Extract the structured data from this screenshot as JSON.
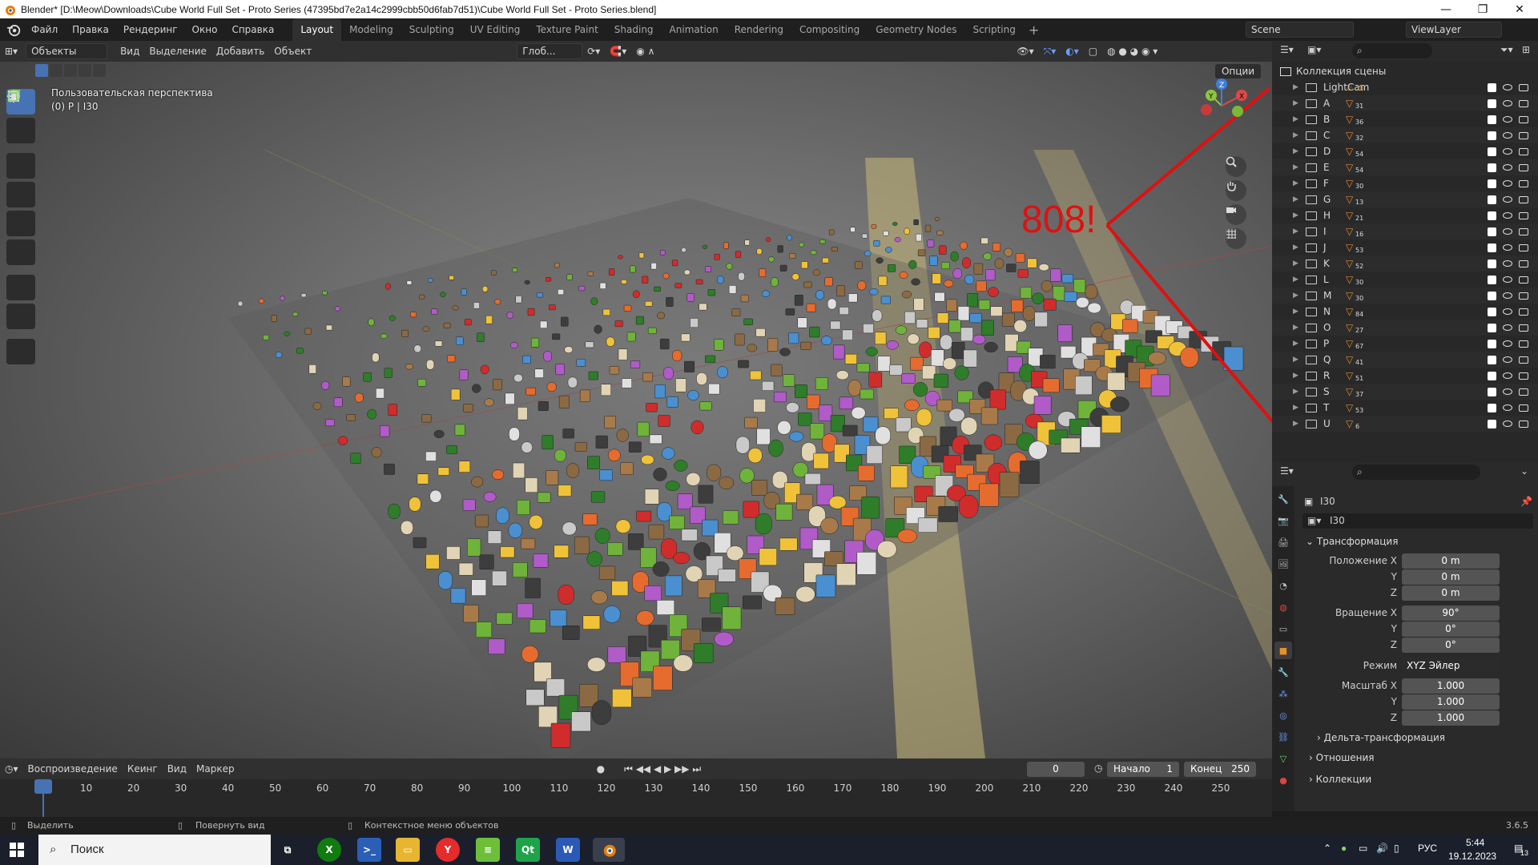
{
  "window": {
    "title": "Blender* [D:\\Meow\\Downloads\\Cube World Full Set - Proto Series (47395bd7e2a14c2999cbb50d6fab7d51)\\Cube World Full Set - Proto Series.blend]",
    "minimize": "—",
    "maximize": "❐",
    "close": "✕"
  },
  "menu": {
    "items": [
      "Файл",
      "Правка",
      "Рендеринг",
      "Окно",
      "Справка"
    ],
    "workspaces": [
      "Layout",
      "Modeling",
      "Sculpting",
      "UV Editing",
      "Texture Paint",
      "Shading",
      "Animation",
      "Rendering",
      "Compositing",
      "Geometry Nodes",
      "Scripting"
    ],
    "active_workspace": "Layout",
    "add_tab": "+",
    "scene": "Scene",
    "view_layer": "ViewLayer"
  },
  "viewport_header": {
    "mode": "Объекты",
    "menus": [
      "Вид",
      "Выделение",
      "Добавить",
      "Объект"
    ],
    "transform_orientation": "Глоб...",
    "options": "Опции"
  },
  "viewport": {
    "perspective": "Пользовательская перспектива",
    "context": "(0) P | I30",
    "annotation": "808!",
    "annotation_color": "#e01010",
    "gizmo": {
      "x": "X",
      "y": "Y",
      "z": "Z"
    }
  },
  "outliner": {
    "root": "Коллекция сцены",
    "rows": [
      {
        "name": "LightCam",
        "count": ""
      },
      {
        "name": "A",
        "count": "31"
      },
      {
        "name": "B",
        "count": "36"
      },
      {
        "name": "C",
        "count": "32"
      },
      {
        "name": "D",
        "count": "54"
      },
      {
        "name": "E",
        "count": "54"
      },
      {
        "name": "F",
        "count": "30"
      },
      {
        "name": "G",
        "count": "13"
      },
      {
        "name": "H",
        "count": "21"
      },
      {
        "name": "I",
        "count": "16"
      },
      {
        "name": "J",
        "count": "53"
      },
      {
        "name": "K",
        "count": "52"
      },
      {
        "name": "L",
        "count": "30"
      },
      {
        "name": "M",
        "count": "30"
      },
      {
        "name": "N",
        "count": "84"
      },
      {
        "name": "O",
        "count": "27"
      },
      {
        "name": "P",
        "count": "67"
      },
      {
        "name": "Q",
        "count": "41"
      },
      {
        "name": "R",
        "count": "51"
      },
      {
        "name": "S",
        "count": "37"
      },
      {
        "name": "T",
        "count": "53"
      },
      {
        "name": "U",
        "count": "6"
      }
    ]
  },
  "properties": {
    "object_name": "I30",
    "data_name": "I30",
    "transform_section": "Трансформация",
    "location_label": "Положение X",
    "location": [
      "0 m",
      "0 m",
      "0 m"
    ],
    "rotation_label": "Вращение X",
    "rotation": [
      "90°",
      "0°",
      "0°"
    ],
    "mode_label": "Режим",
    "rotation_mode": "XYZ Эйлер",
    "scale_label": "Масштаб X",
    "scale": [
      "1.000",
      "1.000",
      "1.000"
    ],
    "axis_y": "Y",
    "axis_z": "Z",
    "delta_transform": "Дельта-трансформация",
    "relations": "Отношения",
    "collections": "Коллекции"
  },
  "timeline": {
    "playback": "Воспроизведение",
    "keying": "Кеинг",
    "view": "Вид",
    "marker": "Маркер",
    "current_frame": "0",
    "start_label": "Начало",
    "start": "1",
    "end_label": "Конец",
    "end": "250",
    "ticks": [
      "0",
      "10",
      "20",
      "30",
      "40",
      "50",
      "60",
      "70",
      "80",
      "90",
      "100",
      "110",
      "120",
      "130",
      "140",
      "150",
      "160",
      "170",
      "180",
      "190",
      "200",
      "210",
      "220",
      "230",
      "240",
      "250"
    ]
  },
  "statusbar": {
    "select": "Выделить",
    "rotate": "Повернуть вид",
    "context_menu": "Контекстное меню объектов",
    "version": "3.6.5"
  },
  "taskbar": {
    "search": "Поиск",
    "lang": "РУС",
    "time": "5:44",
    "date": "19.12.2023",
    "notifications": "13"
  }
}
